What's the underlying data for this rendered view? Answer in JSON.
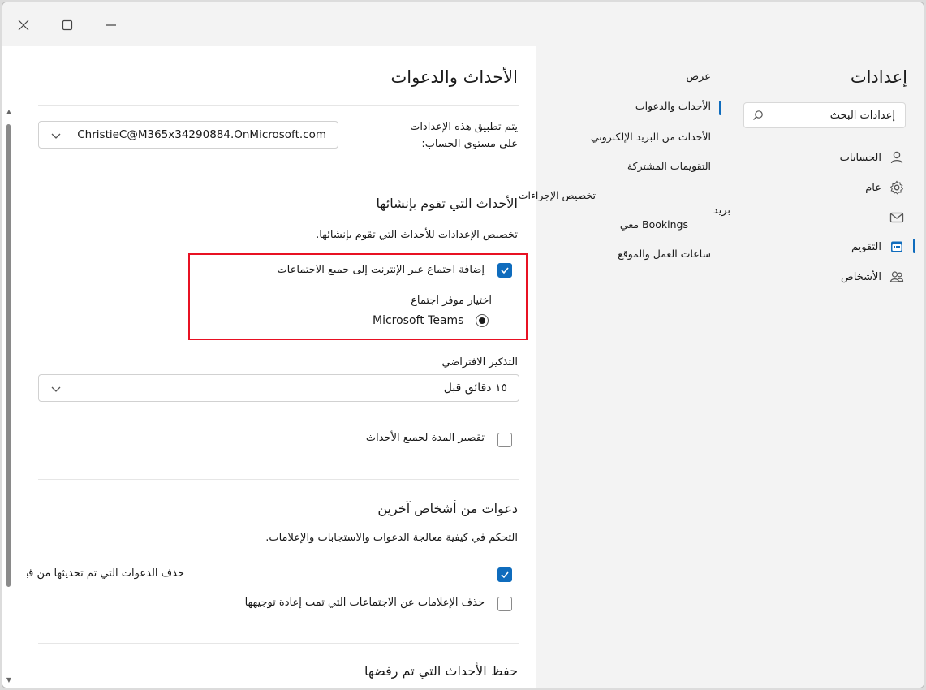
{
  "window": {
    "controls": {
      "close": "close",
      "maximize": "maximize",
      "minimize": "minimize"
    }
  },
  "sidebar": {
    "title": "إعدادات",
    "search_placeholder": "إعدادات البحث",
    "items": [
      {
        "label": "الحسابات",
        "icon": "person-icon"
      },
      {
        "label": "عام",
        "icon": "gear-icon"
      },
      {
        "label": "بريد",
        "icon": "mail-icon"
      },
      {
        "label": "التقويم",
        "icon": "calendar-icon",
        "active": true
      },
      {
        "label": "الأشخاص",
        "icon": "people-icon"
      }
    ]
  },
  "subnav": {
    "heading": "عرض",
    "items": [
      {
        "label": "الأحداث والدعوات",
        "active": true
      },
      {
        "label": "الأحداث من البريد الإلكتروني"
      },
      {
        "label": "التقويمات المشتركة"
      },
      {
        "label": "تخصيص الإجراءات"
      },
      {
        "label": "Bookings معي"
      },
      {
        "label": "ساعات العمل والموقع"
      }
    ]
  },
  "main": {
    "title": "الأحداث والدعوات",
    "account_scope_label_1": "يتم تطبيق هذه الإعدادات",
    "account_scope_label_2": "على مستوى الحساب:",
    "account_value": "ChristieC@M365x34290884.OnMicrosoft.com",
    "events_you_create": {
      "title": "الأحداث التي تقوم بإنشائها",
      "description": "تخصيص الإعدادات للأحداث التي تقوم بإنشائها.",
      "online_meeting_checkbox": {
        "label": "إضافة اجتماع عبر الإنترنت إلى جميع الاجتماعات",
        "checked": true
      },
      "provider_label": "اختيار موفر اجتماع",
      "provider_option": "Microsoft Teams",
      "default_reminder_label": "التذكير الافتراضي",
      "default_reminder_value": "١٥ دقائق قبل",
      "shorten_checkbox": {
        "label": "تقصير المدة لجميع الأحداث",
        "checked": false
      }
    },
    "invitations": {
      "title": "دعوات من أشخاص آخرين",
      "description": "التحكم في كيفية معالجة الدعوات والاستجابات والإعلامات.",
      "delete_updated_checkbox": {
        "label": "حذف الدعوات التي تم تحديثها من قبل المنظم",
        "checked": true
      },
      "delete_forwarded_checkbox": {
        "label": "حذف الإعلامات عن الاجتماعات التي تمت إعادة توجيهها",
        "checked": false
      }
    },
    "declined": {
      "title": "حفظ الأحداث التي تم رفضها"
    }
  },
  "colors": {
    "accent": "#0f6cbd",
    "highlight": "#e81123",
    "nav_bg": "#f3f3f3"
  }
}
